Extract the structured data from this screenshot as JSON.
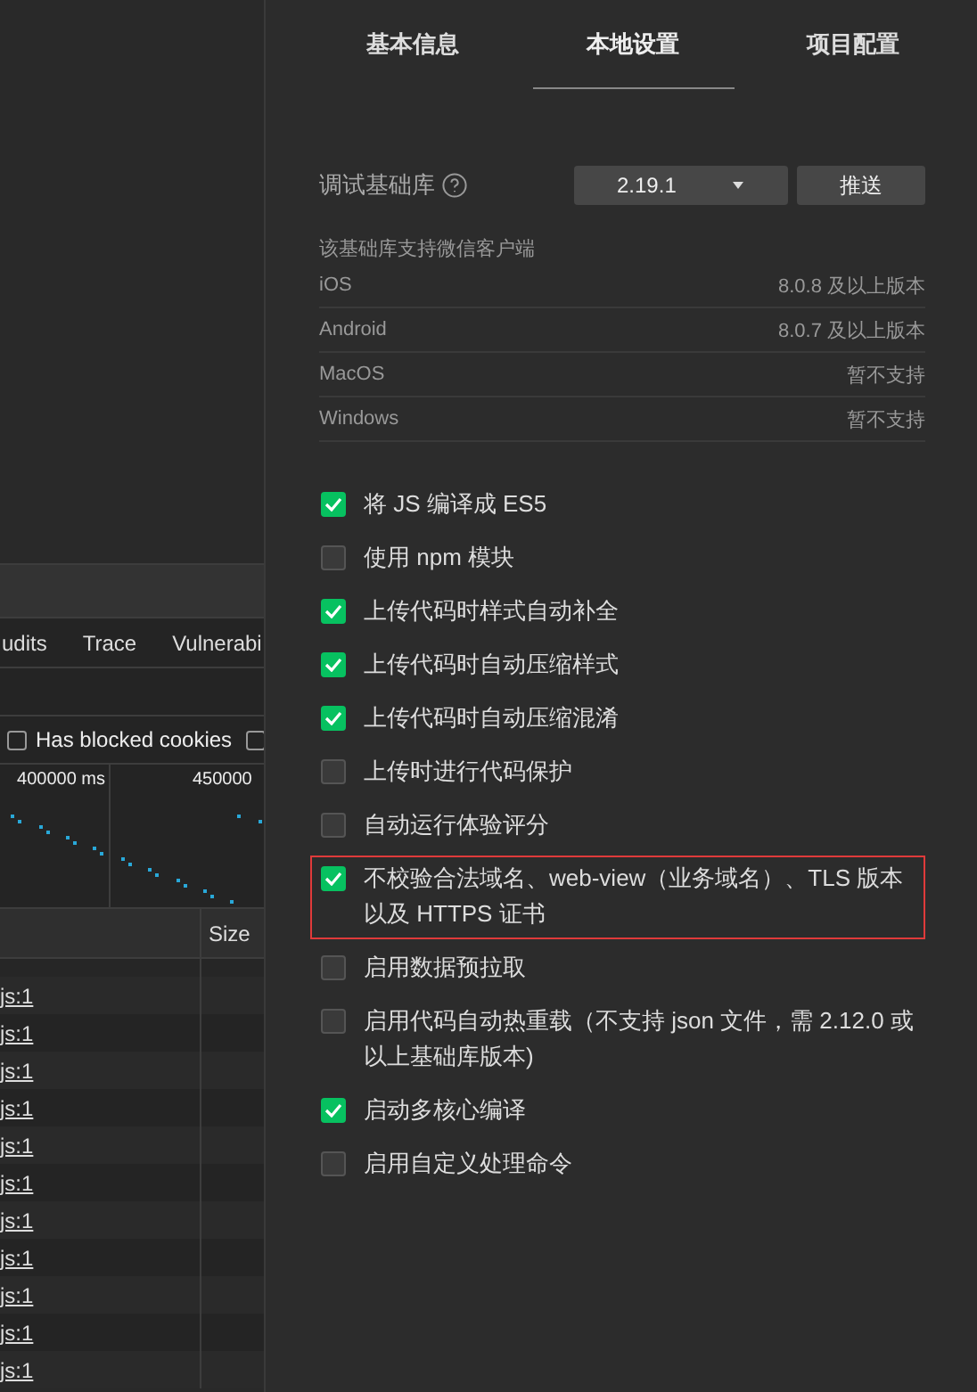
{
  "devtools": {
    "tabs": [
      {
        "label": "udits",
        "selected": false
      },
      {
        "label": "Trace",
        "selected": false
      },
      {
        "label": "Vulnerabi",
        "selected": false
      }
    ],
    "filters": [
      {
        "label": "Has blocked cookies",
        "checked": false
      },
      {
        "checked": false
      }
    ],
    "timeline": {
      "ticks": [
        "400000 ms",
        "450000"
      ]
    },
    "table": {
      "columns": [
        "Size"
      ],
      "rows": [
        {
          "initiator": "js:1"
        },
        {
          "initiator": "js:1"
        },
        {
          "initiator": "js:1"
        },
        {
          "initiator": "js:1"
        },
        {
          "initiator": "js:1"
        },
        {
          "initiator": "js:1"
        },
        {
          "initiator": "js:1"
        },
        {
          "initiator": "js:1"
        },
        {
          "initiator": "js:1"
        },
        {
          "initiator": "js:1"
        },
        {
          "initiator": "js:1"
        }
      ]
    }
  },
  "settings": {
    "tabs": [
      {
        "label": "基本信息",
        "selected": false
      },
      {
        "label": "本地设置",
        "selected": true
      },
      {
        "label": "项目配置",
        "selected": false
      }
    ],
    "base_library": {
      "label": "调试基础库",
      "version": "2.19.1",
      "push_button": "推送"
    },
    "support": {
      "caption": "该基础库支持微信客户端",
      "rows": [
        {
          "platform": "iOS",
          "requirement": "8.0.8 及以上版本"
        },
        {
          "platform": "Android",
          "requirement": "8.0.7 及以上版本"
        },
        {
          "platform": "MacOS",
          "requirement": "暂不支持"
        },
        {
          "platform": "Windows",
          "requirement": "暂不支持"
        }
      ]
    },
    "options": [
      {
        "label": "将 JS 编译成 ES5",
        "checked": true,
        "highlighted": false
      },
      {
        "label": "使用 npm 模块",
        "checked": false,
        "highlighted": false
      },
      {
        "label": "上传代码时样式自动补全",
        "checked": true,
        "highlighted": false
      },
      {
        "label": "上传代码时自动压缩样式",
        "checked": true,
        "highlighted": false
      },
      {
        "label": "上传代码时自动压缩混淆",
        "checked": true,
        "highlighted": false
      },
      {
        "label": "上传时进行代码保护",
        "checked": false,
        "highlighted": false
      },
      {
        "label": "自动运行体验评分",
        "checked": false,
        "highlighted": false
      },
      {
        "label": "不校验合法域名、web-view（业务域名）、TLS 版本以及 HTTPS 证书",
        "checked": true,
        "highlighted": true
      },
      {
        "label": "启用数据预拉取",
        "checked": false,
        "highlighted": false
      },
      {
        "label": "启用代码自动热重载（不支持 json 文件，需 2.12.0 或以上基础库版本)",
        "checked": false,
        "highlighted": false
      },
      {
        "label": "启动多核心编译",
        "checked": true,
        "highlighted": false
      },
      {
        "label": "启用自定义处理命令",
        "checked": false,
        "highlighted": false
      }
    ]
  }
}
